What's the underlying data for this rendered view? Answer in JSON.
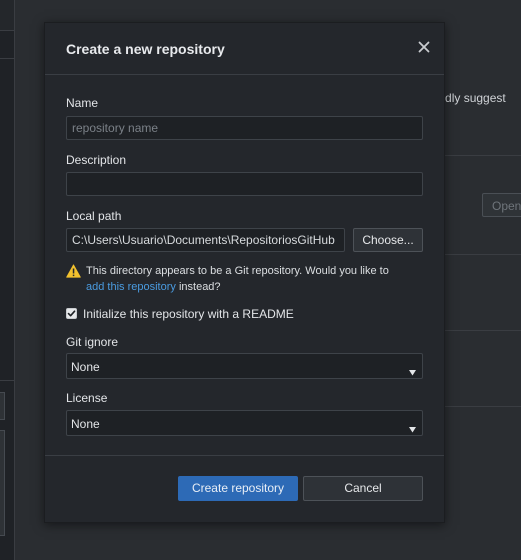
{
  "background": {
    "snippet_text": "iendly suggest",
    "open_button": "Open"
  },
  "dialog": {
    "title": "Create a new repository",
    "close_icon": "close-icon",
    "name": {
      "label": "Name",
      "placeholder": "repository name",
      "value": ""
    },
    "description": {
      "label": "Description",
      "value": ""
    },
    "local_path": {
      "label": "Local path",
      "value": "C:\\Users\\Usuario\\Documents\\RepositoriosGitHub",
      "choose_label": "Choose..."
    },
    "warning": {
      "icon": "warning-icon",
      "text_before": "This directory appears to be a Git repository. Would you like to",
      "link": "add this repository",
      "text_after": "instead?"
    },
    "readme": {
      "checked": true,
      "label": "Initialize this repository with a README"
    },
    "git_ignore": {
      "label": "Git ignore",
      "selected": "None"
    },
    "license": {
      "label": "License",
      "selected": "None"
    },
    "create_button": "Create repository",
    "cancel_button": "Cancel"
  },
  "colors": {
    "accent": "#2d6ab6",
    "link": "#4a9be0",
    "warning": "#f2c12e",
    "dialog_bg": "#24272c"
  }
}
